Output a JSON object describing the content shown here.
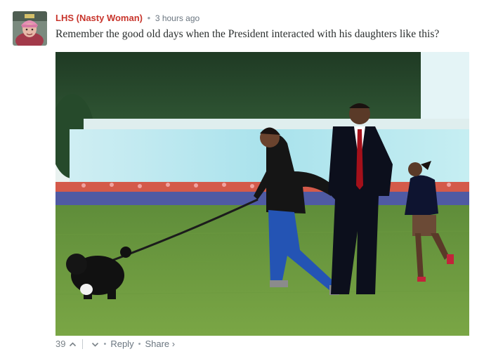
{
  "comment": {
    "author": "LHS (Nasty Woman)",
    "separator": "•",
    "timestamp": "3 hours ago",
    "text": "Remember the good old days when the President interacted with his daughters like this?",
    "votes": "39",
    "reply_label": "Reply",
    "share_label": "Share ›",
    "footer_separator": "•"
  },
  "icons": {
    "upvote": "chevron-up-icon",
    "downvote": "chevron-down-icon"
  },
  "colors": {
    "author": "#c8352c",
    "meta": "#6b7680",
    "text": "#2a2e2e"
  }
}
